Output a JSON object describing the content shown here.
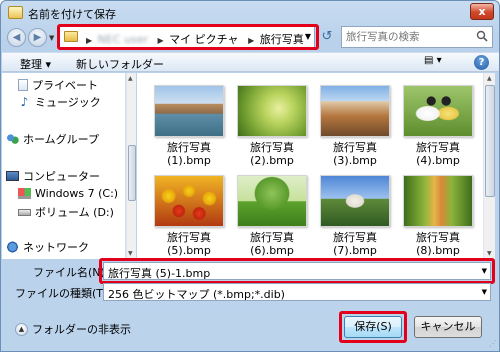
{
  "window": {
    "title": "名前を付けて保存",
    "close_label": "x"
  },
  "address": {
    "crumbs": [
      {
        "label": "NEC user",
        "blurred": true
      },
      {
        "label": "マイ ピクチャ",
        "blurred": false
      },
      {
        "label": "旅行写真",
        "blurred": false
      }
    ],
    "refresh_symbol": "↺"
  },
  "search": {
    "placeholder": "旅行写真の検索"
  },
  "toolbar": {
    "organize_label": "整理 ▾",
    "new_folder_label": "新しいフォルダー",
    "view_label": "▤ ▾",
    "help_label": "?"
  },
  "nav": {
    "items": [
      {
        "label": "プライベート",
        "icon": "document-icon"
      },
      {
        "label": "ミュージック",
        "icon": "music-note-icon"
      },
      {
        "label": "ホームグループ",
        "icon": "homegroup-icon"
      },
      {
        "label": "コンピューター",
        "icon": "computer-icon"
      },
      {
        "label": "Windows 7 (C:)",
        "icon": "windows-drive-icon"
      },
      {
        "label": "ボリューム (D:)",
        "icon": "drive-icon"
      },
      {
        "label": "ネットワーク",
        "icon": "network-icon"
      }
    ]
  },
  "files": [
    {
      "name": "旅行写真 (1).bmp",
      "line1": "旅行写真",
      "line2": "(1).bmp",
      "scene": "canal"
    },
    {
      "name": "旅行写真 (2).bmp",
      "line1": "旅行写真",
      "line2": "(2).bmp",
      "scene": "green-branch"
    },
    {
      "name": "旅行写真 (3).bmp",
      "line1": "旅行写真",
      "line2": "(3).bmp",
      "scene": "mountain-house"
    },
    {
      "name": "旅行写真 (4).bmp",
      "line1": "旅行写真",
      "line2": "(4).bmp",
      "scene": "ducklings"
    },
    {
      "name": "旅行写真 (5).bmp",
      "line1": "旅行写真",
      "line2": "(5).bmp",
      "scene": "tulips"
    },
    {
      "name": "旅行写真 (6).bmp",
      "line1": "旅行写真",
      "line2": "(6).bmp",
      "scene": "park-tree"
    },
    {
      "name": "旅行写真 (7).bmp",
      "line1": "旅行写真",
      "line2": "(7).bmp",
      "scene": "castle"
    },
    {
      "name": "旅行写真 (8).bmp",
      "line1": "旅行写真",
      "line2": "(8).bmp",
      "scene": "autumn-path"
    }
  ],
  "form": {
    "filename_label": "ファイル名(N):",
    "filename_value": "旅行写真 (5)-1.bmp",
    "filetype_label": "ファイルの種類(T):",
    "filetype_value": "256 色ビットマップ (*.bmp;*.dib)"
  },
  "footer": {
    "hide_folders_label": "フォルダーの非表示",
    "save_label": "保存(S)",
    "cancel_label": "キャンセル"
  },
  "colors": {
    "highlight": "#e3001b",
    "accent": "#3c7fb1"
  }
}
